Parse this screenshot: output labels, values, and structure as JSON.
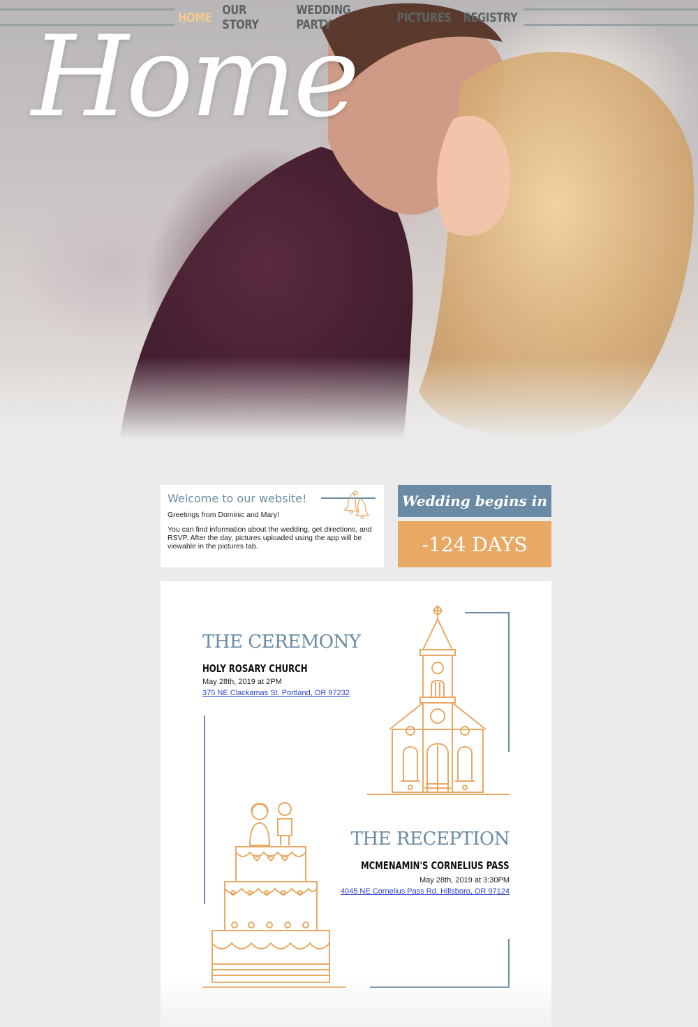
{
  "nav": {
    "items": [
      {
        "label": "Home",
        "active": true
      },
      {
        "label": "Our Story",
        "active": false
      },
      {
        "label": "Wedding Party",
        "active": false
      },
      {
        "label": "Pictures",
        "active": false
      },
      {
        "label": "Registry",
        "active": false
      }
    ]
  },
  "hero": {
    "title": "Home"
  },
  "welcome": {
    "title": "Welcome to our website!",
    "greeting": "Greetings from Dominic and Mary!",
    "body": "You can find information about the wedding, get directions, and RSVP. After the day, pictures uploaded using the app will be viewable in the pictures tab.",
    "icon": "wedding-bells-icon"
  },
  "countdown": {
    "label": "Wedding begins in",
    "value": "-124 DAYS"
  },
  "ceremony": {
    "title": "THE CEREMONY",
    "venue": "HOLY ROSARY CHURCH",
    "datetime": "May 28th, 2019 at 2PM",
    "address": "375 NE Clackamas St. Portland, OR 97232",
    "icon": "church-icon"
  },
  "reception": {
    "title": "THE RECEPTION",
    "venue": "MCMENAMIN'S CORNELIUS PASS",
    "datetime": "May 28th, 2019 at 3:30PM",
    "address": "4045 NE Cornelius Pass Rd. Hillsboro, OR 97124",
    "icon": "wedding-cake-icon"
  },
  "colors": {
    "accent_blue": "#6a8aa3",
    "accent_orange": "#e8a965",
    "nav_active": "#f3c98f",
    "link": "#2a3fd0"
  }
}
